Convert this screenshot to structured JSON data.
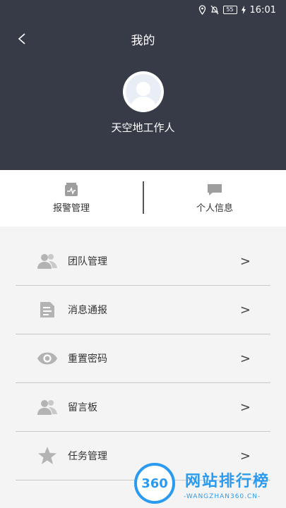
{
  "status_bar": {
    "time": "16:01",
    "battery": "55"
  },
  "header": {
    "title": "我的",
    "back_label": "<",
    "user_name": "天空地工作人"
  },
  "quick_actions": [
    {
      "label": "报警管理",
      "icon": "alarm-box-icon"
    },
    {
      "label": "个人信息",
      "icon": "chat-bubble-icon"
    }
  ],
  "menu": {
    "items": [
      {
        "label": "团队管理",
        "icon": "team-icon"
      },
      {
        "label": "消息通报",
        "icon": "document-icon"
      },
      {
        "label": "重置密码",
        "icon": "eye-icon"
      },
      {
        "label": "留言板",
        "icon": "users-icon"
      },
      {
        "label": "任务管理",
        "icon": "star-icon"
      }
    ],
    "arrow": ">"
  },
  "watermark": {
    "logo_text": "360",
    "title": "网站排行榜",
    "subtitle": "-WANGZHAN360.CN-"
  },
  "colors": {
    "header_bg": "#373a47",
    "accent": "#2a9bf0",
    "icon_gray": "#b3b3b3"
  }
}
